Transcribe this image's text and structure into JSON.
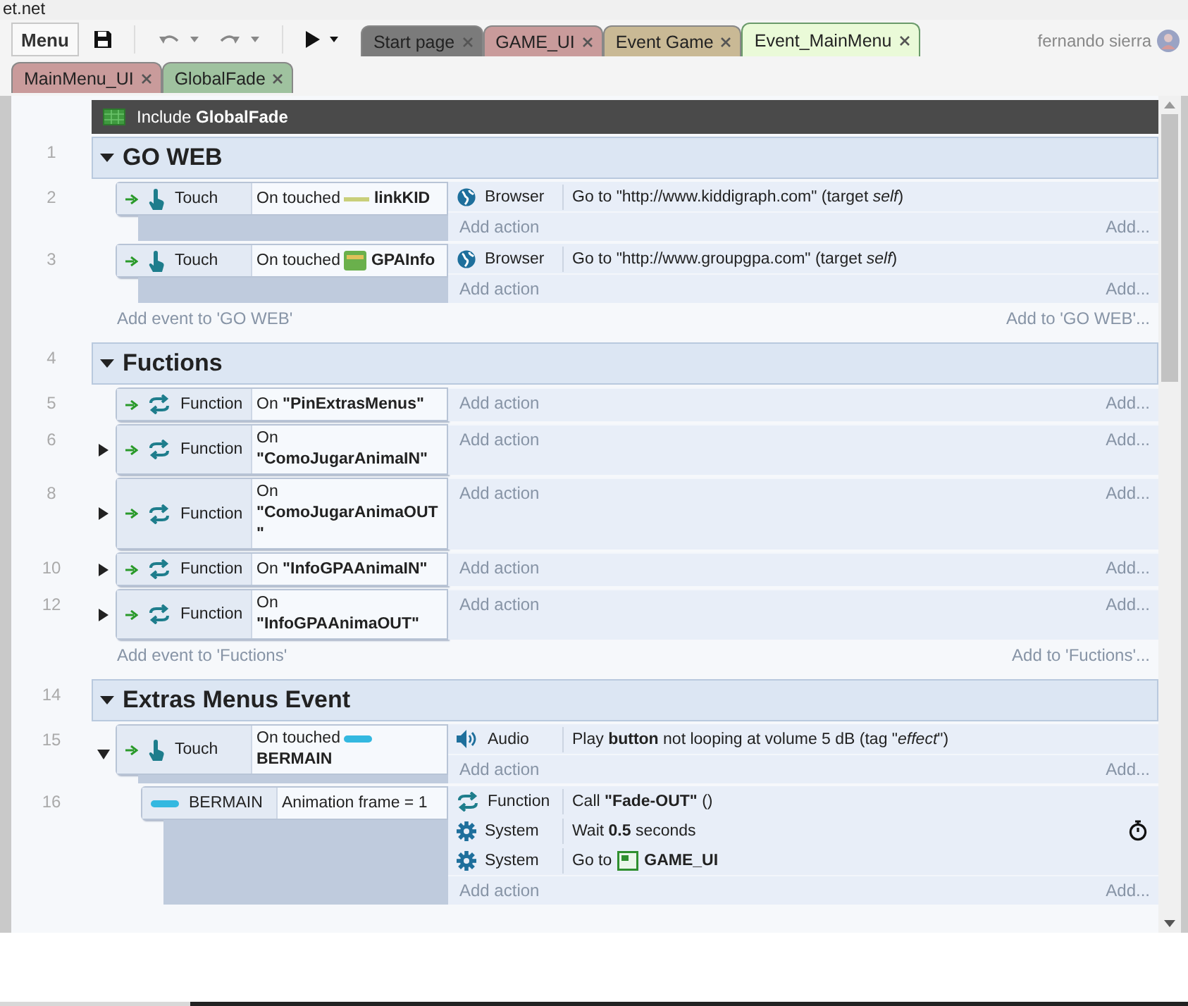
{
  "window_title": "et.net",
  "toolbar": {
    "menu": "Menu"
  },
  "tabs": [
    {
      "label": "Start page",
      "color": "#7b7b7b",
      "selected": false
    },
    {
      "label": "GAME_UI",
      "color": "#c99b9b",
      "selected": false
    },
    {
      "label": "Event Game",
      "color": "#c9b995",
      "selected": false
    },
    {
      "label": "Event_MainMenu",
      "color": "#eafad8",
      "selected": true
    },
    {
      "label": "MainMenu_UI",
      "color": "#c99b9b",
      "selected": false
    },
    {
      "label": "GlobalFade",
      "color": "#9fc29f",
      "selected": false
    }
  ],
  "user": {
    "name": "fernando sierra"
  },
  "include": {
    "text": "Include **GlobalFade**"
  },
  "groups": [
    {
      "number": "1",
      "title": "GO WEB",
      "expanded": true,
      "add_event": "Add event to 'GO WEB'",
      "add_to": "Add to 'GO WEB'...",
      "events": [
        {
          "number": "2",
          "collapsible": false,
          "conditions": [
            {
              "trigger": true,
              "object": "Touch",
              "kind": "touch",
              "text": "On touched",
              "target": {
                "name": "linkKID",
                "kind": "line"
              }
            }
          ],
          "actions": [
            {
              "object": "Browser",
              "kind": "browser",
              "text": "Go to \"http://www.kiddigraph.com\" (target *self*)"
            }
          ],
          "add_action": "Add action",
          "add": "Add..."
        },
        {
          "number": "3",
          "collapsible": false,
          "conditions": [
            {
              "trigger": true,
              "object": "Touch",
              "kind": "touch",
              "text": "On touched",
              "target": {
                "name": "GPAInfo",
                "kind": "sprite"
              }
            }
          ],
          "actions": [
            {
              "object": "Browser",
              "kind": "browser",
              "text": "Go to \"http://www.groupgpa.com\" (target *self*)"
            }
          ],
          "add_action": "Add action",
          "add": "Add..."
        }
      ]
    },
    {
      "number": "4",
      "title": "Fuctions",
      "expanded": true,
      "add_event": "Add event to 'Fuctions'",
      "add_to": "Add to 'Fuctions'...",
      "events": [
        {
          "number": "5",
          "collapsible": false,
          "conditions": [
            {
              "trigger": true,
              "object": "Function",
              "kind": "function",
              "text": "On **\"PinExtrasMenus\"**"
            }
          ],
          "add_action": "Add action",
          "add": "Add..."
        },
        {
          "number": "6",
          "collapsible": true,
          "expanded": false,
          "conditions": [
            {
              "trigger": true,
              "object": "Function",
              "kind": "function",
              "text": "On **\"ComoJugarAnimaIN\"**"
            }
          ],
          "add_action": "Add action",
          "add": "Add..."
        },
        {
          "number": "8",
          "collapsible": true,
          "expanded": false,
          "conditions": [
            {
              "trigger": true,
              "object": "Function",
              "kind": "function",
              "text": "On **\"ComoJugarAnimaOUT\"**"
            }
          ],
          "add_action": "Add action",
          "add": "Add..."
        },
        {
          "number": "10",
          "collapsible": true,
          "expanded": false,
          "conditions": [
            {
              "trigger": true,
              "object": "Function",
              "kind": "function",
              "text": "On **\"InfoGPAAnimaIN\"**"
            }
          ],
          "add_action": "Add action",
          "add": "Add..."
        },
        {
          "number": "12",
          "collapsible": true,
          "expanded": false,
          "conditions": [
            {
              "trigger": true,
              "object": "Function",
              "kind": "function",
              "text": "On **\"InfoGPAAnimaOUT\"**"
            }
          ],
          "add_action": "Add action",
          "add": "Add..."
        }
      ]
    },
    {
      "number": "14",
      "title": "Extras Menus Event",
      "expanded": true,
      "events": [
        {
          "number": "15",
          "collapsible": true,
          "expanded": true,
          "conditions": [
            {
              "trigger": true,
              "object": "Touch",
              "kind": "touch",
              "text": "On touched",
              "target": {
                "name": "BERMAIN",
                "kind": "bar"
              }
            }
          ],
          "actions": [
            {
              "object": "Audio",
              "kind": "audio",
              "text": "Play **button** not looping at volume 5 dB (tag \"*effect*\")"
            }
          ],
          "add_action": "Add action",
          "add": "Add...",
          "children": [
            {
              "number": "16",
              "collapsible": false,
              "conditions": [
                {
                  "trigger": false,
                  "object": "BERMAIN",
                  "kind": "bar",
                  "text": "Animation frame = 1"
                }
              ],
              "actions": [
                {
                  "object": "Function",
                  "kind": "function",
                  "text": "Call **\"Fade-OUT\"** ()"
                },
                {
                  "object": "System",
                  "kind": "system",
                  "text": "Wait **0.5** seconds",
                  "timer": true
                },
                {
                  "object": "System",
                  "kind": "system",
                  "text": "Go to",
                  "target": {
                    "name": "GAME_UI",
                    "kind": "layout"
                  }
                }
              ],
              "add_action": "Add action",
              "add": "Add..."
            }
          ]
        }
      ]
    }
  ]
}
